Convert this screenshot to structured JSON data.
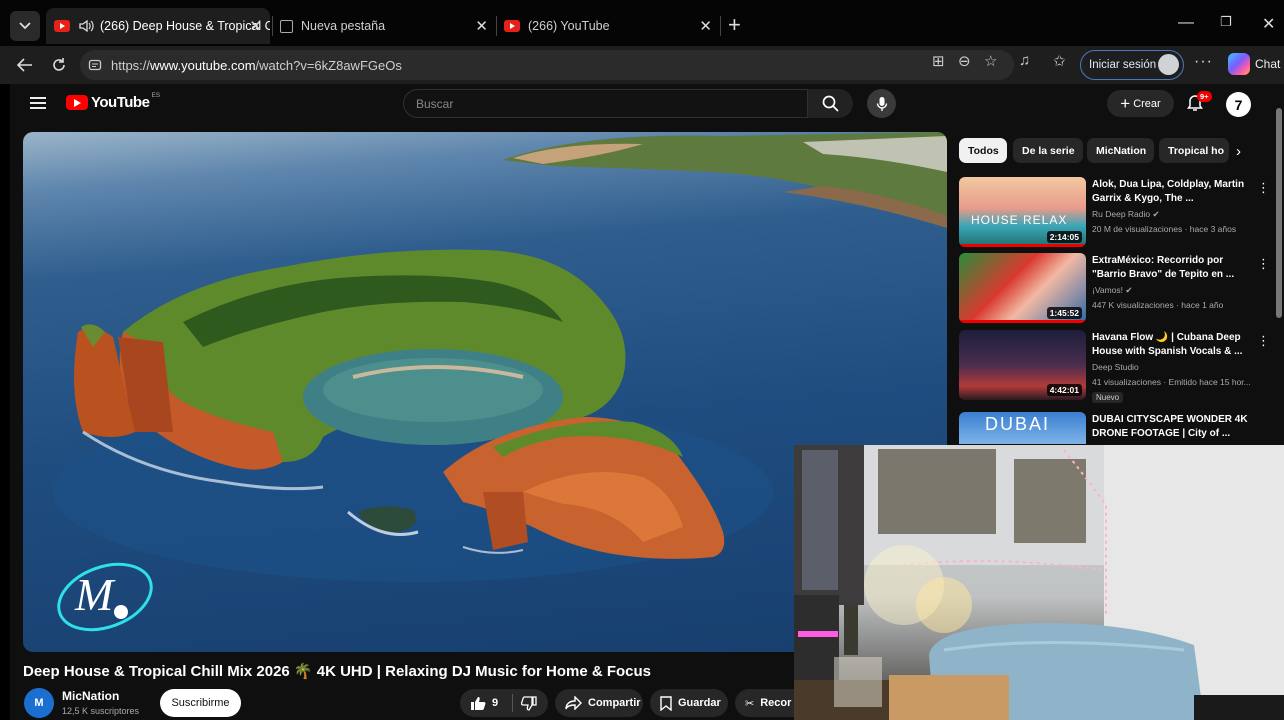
{
  "browser": {
    "tabs": [
      {
        "title": "(266) Deep House & Tropical C",
        "active": true,
        "audio": true
      },
      {
        "title": "Nueva pestaña",
        "active": false
      },
      {
        "title": "(266) YouTube",
        "active": false
      }
    ],
    "address": {
      "prefix": "https://",
      "host": "www.youtube.com",
      "path": "/watch?v=6kZ8awFGeOs"
    },
    "signin_label": "Iniciar sesión",
    "chat_label": "Chat"
  },
  "youtube": {
    "logo_text": "YouTube",
    "country_code": "ES",
    "search_placeholder": "Buscar",
    "create_label": "Crear",
    "notifications_badge": "9+",
    "video": {
      "title": "Deep House & Tropical Chill Mix 2026 🌴 4K UHD | Relaxing DJ Music for Home & Focus",
      "channel": "MicNation",
      "subscribers": "12,5 K suscriptores",
      "subscribe_label": "Suscribirme",
      "likes": "9",
      "share_label": "Compartir",
      "save_label": "Guardar",
      "clip_label": "Recor"
    },
    "chips": [
      {
        "label": "Todos",
        "active": true
      },
      {
        "label": "De la serie"
      },
      {
        "label": "MicNation"
      },
      {
        "label": "Tropical ho"
      }
    ],
    "recommendations": [
      {
        "title": "Alok, Dua Lipa, Coldplay, Martin Garrix & Kygo, The ...",
        "channel": "Ru Deep Radio",
        "verified": true,
        "meta": "20 M de visualizaciones · hace 3 años",
        "duration": "2:14:05",
        "thumb_text": "HOUSE   RELAX"
      },
      {
        "title": "ExtraMéxico: Recorrido por \"Barrio Bravo\" de Tepito en ...",
        "channel": "¡Vamos!",
        "verified": true,
        "meta": "447 K visualizaciones · hace 1 año",
        "duration": "1:45:52"
      },
      {
        "title": "Havana Flow 🌙 | Cubana Deep House with Spanish Vocals & ...",
        "channel": "Deep Studio",
        "verified": false,
        "meta": "41 visualizaciones · Emitido hace 15 hor...",
        "duration": "4:42:01",
        "badge": "Nuevo"
      },
      {
        "title": "DUBAI CITYSCAPE WONDER 4K DRONE FOOTAGE | City of ...",
        "thumb_text": "DUBAI"
      }
    ]
  }
}
